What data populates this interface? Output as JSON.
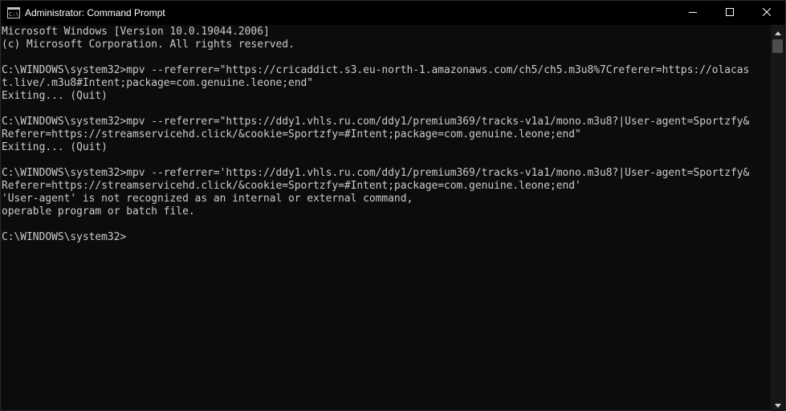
{
  "window": {
    "title": "Administrator: Command Prompt",
    "app_icon": "cmd-icon"
  },
  "caption_buttons": {
    "minimize_icon": "minimize-icon",
    "maximize_icon": "maximize-icon",
    "close_icon": "close-icon"
  },
  "colors": {
    "background": "#0c0c0c",
    "text": "#cccccc",
    "titlebar": "#000000",
    "scrollbar_track": "#171717",
    "scrollbar_thumb": "#4d4d4d"
  },
  "console": {
    "lines": [
      "Microsoft Windows [Version 10.0.19044.2006]",
      "(c) Microsoft Corporation. All rights reserved.",
      "",
      "C:\\WINDOWS\\system32>mpv --referrer=\"https://cricaddict.s3.eu-north-1.amazonaws.com/ch5/ch5.m3u8%7Creferer=https://olacas",
      "t.live/.m3u8#Intent;package=com.genuine.leone;end\"",
      "Exiting... (Quit)",
      "",
      "C:\\WINDOWS\\system32>mpv --referrer=\"https://ddy1.vhls.ru.com/ddy1/premium369/tracks-v1a1/mono.m3u8?|User-agent=Sportzfy&",
      "Referer=https://streamservicehd.click/&cookie=Sportzfy=#Intent;package=com.genuine.leone;end\"",
      "Exiting... (Quit)",
      "",
      "C:\\WINDOWS\\system32>mpv --referrer='https://ddy1.vhls.ru.com/ddy1/premium369/tracks-v1a1/mono.m3u8?|User-agent=Sportzfy&",
      "Referer=https://streamservicehd.click/&cookie=Sportzfy=#Intent;package=com.genuine.leone;end'",
      "'User-agent' is not recognized as an internal or external command,",
      "operable program or batch file.",
      "",
      "C:\\WINDOWS\\system32>"
    ]
  }
}
